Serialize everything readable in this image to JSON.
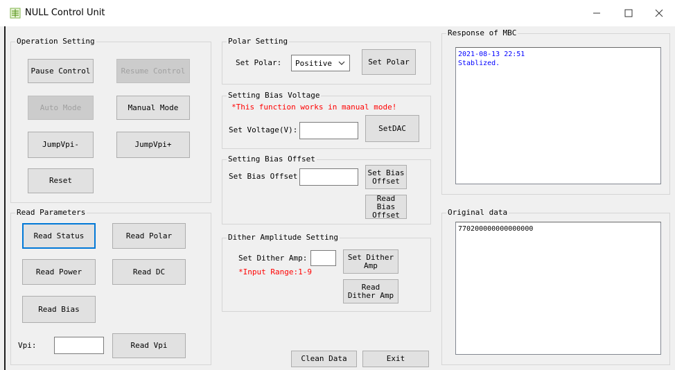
{
  "window": {
    "title": "NULL Control Unit",
    "minimize_glyph": "—",
    "maximize_glyph": "☐",
    "close_glyph": "✕"
  },
  "operation": {
    "title": "Operation Setting",
    "pause_control": "Pause Control",
    "resume_control": "Resume Control",
    "auto_mode": "Auto Mode",
    "manual_mode": "Manual Mode",
    "jump_vpi_minus": "JumpVpi-",
    "jump_vpi_plus": "JumpVpi+",
    "reset": "Reset"
  },
  "read_params": {
    "title": "Read Parameters",
    "read_status": "Read Status",
    "read_polar": "Read Polar",
    "read_power": "Read Power",
    "read_dc": "Read DC",
    "read_bias": "Read Bias",
    "vpi_label": "Vpi:",
    "vpi_value": "",
    "read_vpi": "Read Vpi"
  },
  "polar": {
    "title": "Polar Setting",
    "set_polar_label": "Set Polar:",
    "selected": "Positive",
    "set_polar_button": "Set Polar"
  },
  "bias_voltage": {
    "title": "Setting Bias Voltage",
    "note": "*This function works in manual mode!",
    "set_voltage_label": "Set Voltage(V):",
    "voltage_value": "",
    "set_dac_button": "SetDAC"
  },
  "bias_offset": {
    "title": "Setting Bias Offset",
    "set_offset_label": "Set Bias Offset:",
    "offset_value": "",
    "set_offset_button": "Set Bias\nOffset",
    "read_offset_button": "Read Bias\nOffset"
  },
  "dither": {
    "title": "Dither Amplitude Setting",
    "set_amp_label": "Set Dither Amp:",
    "amp_value": "",
    "range_note": "*Input Range:1-9",
    "set_amp_button": "Set Dither\nAmp",
    "read_amp_button": "Read\nDither Amp"
  },
  "bottom": {
    "clean_data": "Clean Data",
    "exit": "Exit"
  },
  "response": {
    "title": "Response of MBC",
    "lines": [
      "2021-08-13 22:51",
      "Stablized."
    ],
    "text_color": "#0000ff"
  },
  "original": {
    "title": "Original data",
    "lines": [
      "770200000000000000"
    ]
  }
}
